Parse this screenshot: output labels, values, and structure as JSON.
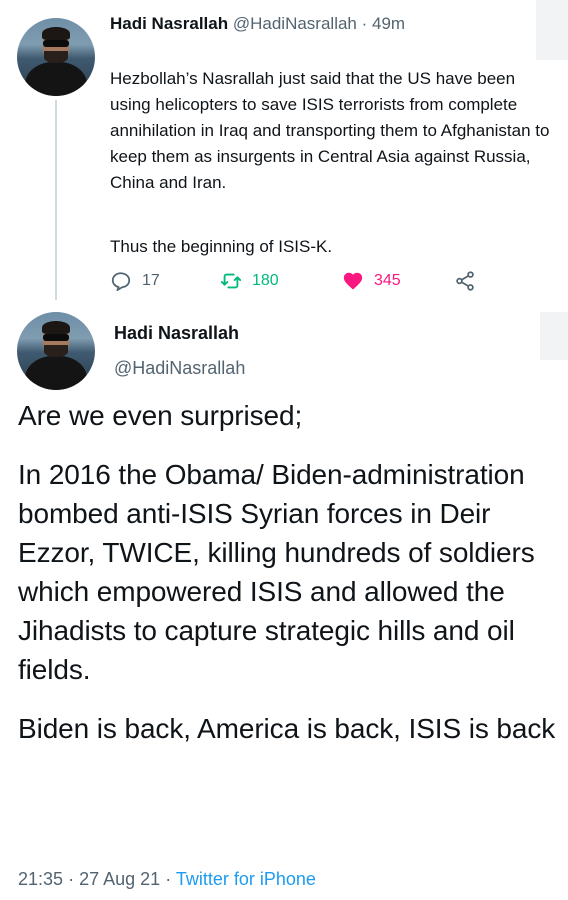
{
  "parent_tweet": {
    "author_name": "Hadi Nasrallah",
    "author_handle": "@HadiNasrallah",
    "separator": "·",
    "timestamp": "49m",
    "text": "Hezbollah’s Nasrallah just said that the US have been using helicopters to save ISIS terrorists from complete annihilation in Iraq and transporting them to Afghanistan to keep them as insurgents in Central Asia against Russia, China and Iran.",
    "text_line2": "Thus the beginning of ISIS-K.",
    "reply_count": "17",
    "retweet_count": "180",
    "like_count": "345",
    "colors": {
      "retweet": "#00ba7c",
      "like": "#f91880",
      "muted": "#536471"
    },
    "icons": [
      "reply-icon",
      "retweet-icon",
      "heart-icon",
      "share-icon"
    ]
  },
  "main_tweet": {
    "author_name": "Hadi Nasrallah",
    "author_handle": "@HadiNasrallah",
    "paragraphs": [
      "Are we even surprised;",
      "In 2016 the Obama/ Biden-administration bombed anti-ISIS Syrian forces in Deir Ezzor, TWICE, killing hundreds of soldiers which empowered ISIS and allowed the Jihadists to capture strategic hills and oil fields.",
      "Biden is back, America is back, ISIS is back"
    ],
    "time": "21:35",
    "separator": "·",
    "date": "27 Aug 21",
    "separator2": "·",
    "source": "Twitter for iPhone",
    "link_color": "#1d9bf0"
  }
}
